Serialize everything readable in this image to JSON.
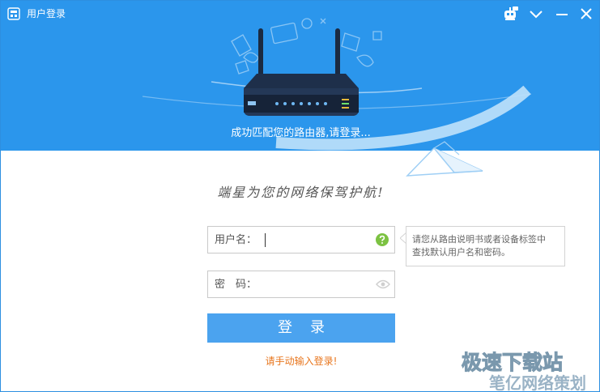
{
  "window": {
    "title": "用户登录"
  },
  "header": {
    "status_text": "成功匹配您的路由器,请登录..."
  },
  "slogan": "端星为您的网络保驾护航!",
  "form": {
    "username_label": "用户名：",
    "username_value": "",
    "password_label": "密　码：",
    "password_value": "",
    "login_label": "登录",
    "hint_text": "请手动输入登录!"
  },
  "tooltip": {
    "line1": "请您从路由说明书或者设备标签中",
    "line2": "查找默认用户名和密码。"
  },
  "watermark": {
    "line1": "极速下载站",
    "line2": "笔亿网络策划"
  },
  "colors": {
    "header_blue": "#2b96ec",
    "button_blue": "#4ba3ef",
    "hint_orange": "#e8761e",
    "help_green": "#7cc242"
  },
  "icons": {
    "app": "router-window-icon",
    "robot": "robot-icon",
    "dropdown": "chevron-down-icon",
    "minimize": "minimize-icon",
    "close": "close-icon",
    "help": "question-icon",
    "show_password": "eye-icon"
  }
}
